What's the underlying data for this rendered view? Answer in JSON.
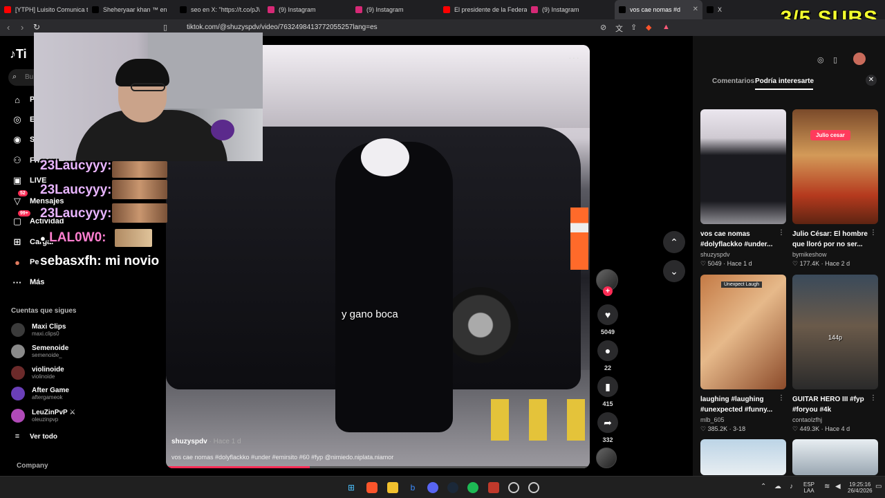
{
  "tabs": [
    {
      "label": "[YTPH] Luisito Comunica t",
      "fav_color": "#ff0000"
    },
    {
      "label": "Sheheryaar khan ™ en",
      "fav_color": "#000000"
    },
    {
      "label": "seo en X: \"https://t.co/pJ\\",
      "fav_color": "#000000"
    },
    {
      "label": "(9) Instagram",
      "fav_color": "#d62976"
    },
    {
      "label": "(9) Instagram",
      "fav_color": "#d62976"
    },
    {
      "label": "El presidente de la Federa",
      "fav_color": "#ff0000"
    },
    {
      "label": "(9) Instagram",
      "fav_color": "#d62976"
    },
    {
      "label": "vos cae nomas #d",
      "fav_color": "#000000"
    },
    {
      "label": "X",
      "fav_color": "#000000"
    }
  ],
  "subs_overlay": "3/5 SUBS",
  "url": "tiktok.com/@shuzyspdv/video/7632498413772055257lang=es",
  "sidebar": {
    "search_placeholder": "Bu",
    "nav": [
      {
        "label": "P",
        "icon": "home-icon"
      },
      {
        "label": "E",
        "icon": "explore-icon"
      },
      {
        "label": "S",
        "icon": "following-icon"
      },
      {
        "label": "Frien",
        "icon": "friends-icon"
      },
      {
        "label": "LIVE",
        "icon": "live-icon"
      },
      {
        "label": "Mensajes",
        "icon": "messages-icon",
        "badge": "52"
      },
      {
        "label": "Actividad",
        "icon": "activity-icon",
        "badge": "99+"
      },
      {
        "label": "Cargar",
        "icon": "upload-icon"
      },
      {
        "label": "Pe",
        "icon": "profile-icon"
      },
      {
        "label": "Más",
        "icon": "more-icon"
      }
    ],
    "following_title": "Cuentas que sigues",
    "following": [
      {
        "name": "Maxi Clips",
        "handle": "maxi.clips0"
      },
      {
        "name": "Semenoide",
        "handle": "semenoide_"
      },
      {
        "name": "violinoide",
        "handle": "violinoide"
      },
      {
        "name": "After Game",
        "handle": "aftergameok"
      },
      {
        "name": "LeuZinPvP ⚔",
        "handle": "oleuzinpvp"
      }
    ],
    "see_all": "Ver todo",
    "company": "Company"
  },
  "chat": [
    {
      "user": "23Laucyyy:",
      "msg": ""
    },
    {
      "user": "23Laucyyy:",
      "msg": ""
    },
    {
      "user": "23Laucyyy:",
      "msg": ""
    },
    {
      "user": "LAL0W0:",
      "msg": ""
    },
    {
      "user": "sebasxfh:",
      "msg": "mi novio"
    }
  ],
  "video": {
    "caption": "y gano boca",
    "author": "shuzyspdv",
    "time": "· Hace 1 d",
    "description": "vos cae nomas #dolyflackko #under #emirsito #60 #fyp @nimiedo.niplata.niamor",
    "progress": 0.34
  },
  "actions": {
    "likes": "5049",
    "comments": "22",
    "saves": "415",
    "shares": "332"
  },
  "panel": {
    "tab_comments": "Comentarios",
    "tab_related": "Podría interesarte",
    "cards": [
      {
        "title1": "vos cae nomas",
        "title2": "#dolyflackko #under...",
        "author": "shuzyspdv",
        "stats": "♡ 5049 · Hace 1 d"
      },
      {
        "title1": "Julio César: El hombre",
        "title2": "que lloró por no ser...",
        "author": "bymikeshow",
        "stats": "♡ 177.4K · Hace 2 d",
        "tag": "Julio cesar"
      },
      {
        "title1": "laughing #laughing",
        "title2": "#unexpected #funny...",
        "author": "mlb_605",
        "stats": "♡ 385.2K · 3-18",
        "sub": "Unexpect Laugh"
      },
      {
        "title1": "GUITAR HERO III #fyp",
        "title2": "#foryou #4k",
        "author": "contaolzfhj",
        "stats": "♡ 449.3K · Hace 4 d",
        "quality": "144p"
      }
    ]
  },
  "taskbar": {
    "lang1": "ESP",
    "lang2": "LAA",
    "time": "19:25:16",
    "date": "26/4/2026"
  }
}
